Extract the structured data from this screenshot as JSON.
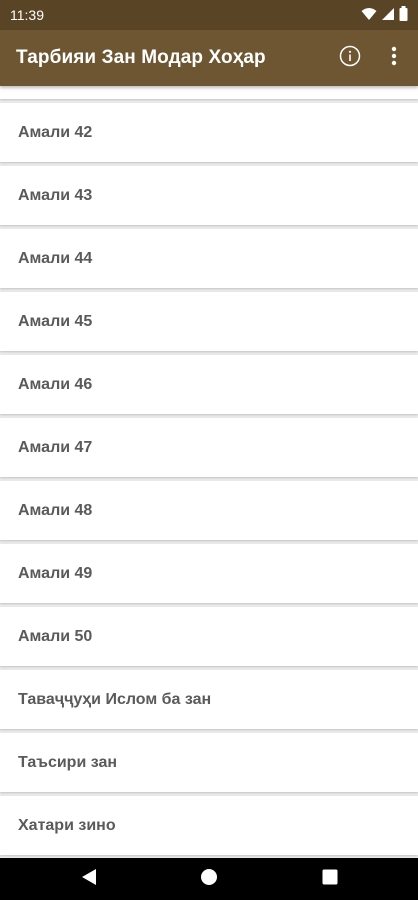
{
  "status_bar": {
    "time": "11:39",
    "icons": [
      "wifi-icon",
      "signal-icon",
      "battery-icon"
    ]
  },
  "app_bar": {
    "title": "Тарбияи Зан Модар Хоҳар",
    "actions": [
      "info-icon",
      "more-vert-icon"
    ]
  },
  "list": {
    "items": [
      {
        "label": ""
      },
      {
        "label": "Амали 42"
      },
      {
        "label": "Амали 43"
      },
      {
        "label": "Амали 44"
      },
      {
        "label": "Амали 45"
      },
      {
        "label": "Амали 46"
      },
      {
        "label": "Амали 47"
      },
      {
        "label": "Амали 48"
      },
      {
        "label": "Амали 49"
      },
      {
        "label": "Амали 50"
      },
      {
        "label": "Таваҷҷуҳи Ислом ба зан"
      },
      {
        "label": "Таъсири зан"
      },
      {
        "label": "Хатари зино"
      }
    ]
  },
  "nav_bar": {
    "buttons": [
      "back-icon",
      "home-icon",
      "recents-icon"
    ]
  },
  "colors": {
    "status_bar": "#5a4426",
    "app_bar": "#6e5632",
    "list_background": "#ececec",
    "item_text": "#5a5a5a"
  }
}
